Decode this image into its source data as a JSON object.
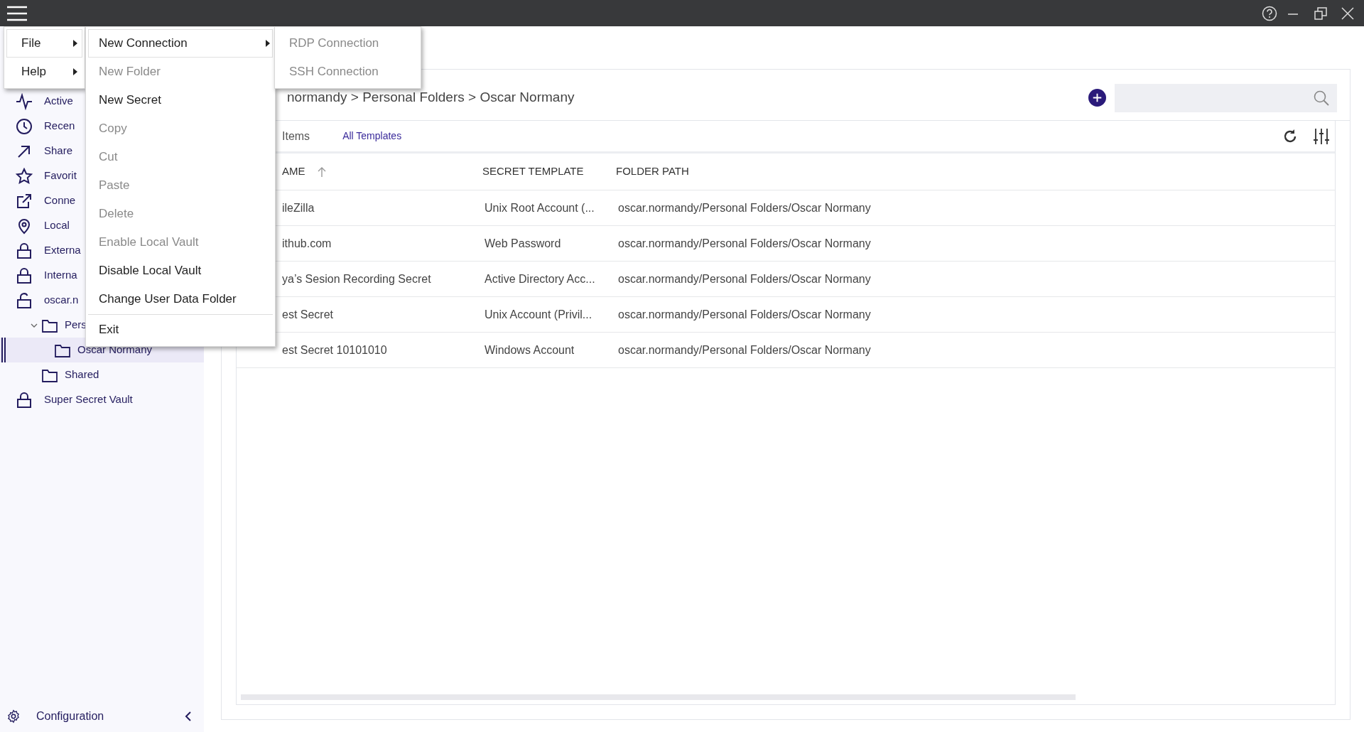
{
  "menu_bar": [
    {
      "label": "File",
      "selected": true
    },
    {
      "label": "Help",
      "selected": false
    }
  ],
  "file_menu": [
    {
      "label": "New Connection",
      "disabled": false,
      "selected": true,
      "submenu": true
    },
    {
      "label": "New Folder",
      "disabled": true,
      "selected": false,
      "submenu": false
    },
    {
      "label": "New Secret",
      "disabled": false,
      "selected": false,
      "submenu": false
    },
    {
      "label": "Copy",
      "disabled": true,
      "selected": false,
      "submenu": false
    },
    {
      "label": "Cut",
      "disabled": true,
      "selected": false,
      "submenu": false
    },
    {
      "label": "Paste",
      "disabled": true,
      "selected": false,
      "submenu": false
    },
    {
      "label": "Delete",
      "disabled": true,
      "selected": false,
      "submenu": false
    },
    {
      "label": "Enable Local Vault",
      "disabled": true,
      "selected": false,
      "submenu": false
    },
    {
      "label": "Disable Local Vault",
      "disabled": false,
      "selected": false,
      "submenu": false
    },
    {
      "label": "Change User Data Folder",
      "disabled": false,
      "selected": false,
      "submenu": false
    },
    {
      "label": "Exit",
      "disabled": false,
      "selected": false,
      "submenu": false,
      "separator_before": true
    }
  ],
  "submenu": [
    {
      "label": "RDP Connection",
      "disabled": true
    },
    {
      "label": "SSH Connection",
      "disabled": true
    }
  ],
  "sidebar": {
    "items": [
      {
        "label": "Active",
        "kind": "activity",
        "selected": false
      },
      {
        "label": "Recen",
        "kind": "clock",
        "selected": false
      },
      {
        "label": "Share",
        "kind": "arrow",
        "selected": false
      },
      {
        "label": "Favorit",
        "kind": "star",
        "selected": false
      },
      {
        "label": "Conne",
        "kind": "external",
        "selected": false
      },
      {
        "label": "Local",
        "kind": "pin",
        "selected": false
      },
      {
        "label": "Externa",
        "kind": "lock",
        "selected": false
      },
      {
        "label": "Interna",
        "kind": "lock",
        "selected": false
      },
      {
        "label": "oscar.n",
        "kind": "unlock",
        "selected": false,
        "children": [
          {
            "label": "Pers",
            "kind": "folder",
            "selected": false,
            "expanded": true,
            "children": [
              {
                "label": "Oscar Normany",
                "kind": "folder",
                "selected": true
              }
            ]
          },
          {
            "label": "Shared",
            "kind": "folder",
            "selected": false
          }
        ]
      },
      {
        "label": "Super Secret Vault",
        "kind": "lock",
        "selected": false
      }
    ],
    "footer": "Configuration"
  },
  "breadcrumb": "normandy > Personal Folders > Oscar Normany",
  "toolbar": {
    "count": "Items",
    "filter": "All Templates"
  },
  "table": {
    "columns": [
      "AME",
      "SECRET TEMPLATE",
      "FOLDER PATH"
    ],
    "rows": [
      {
        "name": "ileZilla",
        "template": "Unix Root Account (...",
        "path": "oscar.normandy/Personal Folders/Oscar Normany"
      },
      {
        "name": "ithub.com",
        "template": "Web Password",
        "path": "oscar.normandy/Personal Folders/Oscar Normany"
      },
      {
        "name": "ya’s Sesion Recording Secret",
        "template": "Active Directory Acc...",
        "path": "oscar.normandy/Personal Folders/Oscar Normany"
      },
      {
        "name": "est Secret",
        "template": "Unix Account (Privil...",
        "path": "oscar.normandy/Personal Folders/Oscar Normany"
      },
      {
        "name": "est Secret 10101010",
        "template": "Windows Account",
        "path": "oscar.normandy/Personal Folders/Oscar Normany"
      }
    ]
  }
}
